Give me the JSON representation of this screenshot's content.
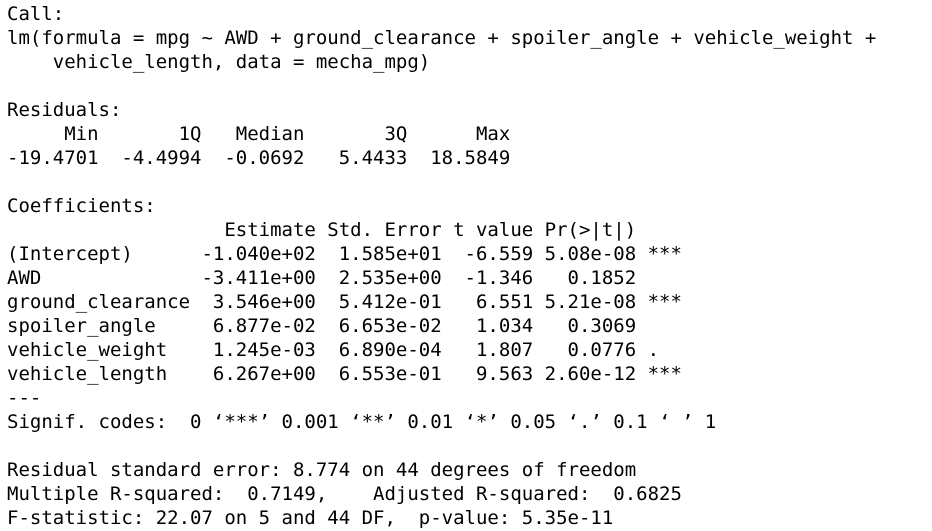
{
  "console": {
    "text_color": "#000000",
    "background_color": "#ffffff",
    "lines": [
      "Call:",
      "lm(formula = mpg ~ AWD + ground_clearance + spoiler_angle + vehicle_weight +",
      "    vehicle_length, data = mecha_mpg)",
      "",
      "Residuals:",
      "     Min       1Q   Median       3Q      Max ",
      "-19.4701  -4.4994  -0.0692   5.4433  18.5849 ",
      "",
      "Coefficients:",
      "                   Estimate Std. Error t value Pr(>|t|)    ",
      "(Intercept)      -1.040e+02  1.585e+01  -6.559 5.08e-08 ***",
      "AWD              -3.411e+00  2.535e+00  -1.346   0.1852    ",
      "ground_clearance  3.546e+00  5.412e-01   6.551 5.21e-08 ***",
      "spoiler_angle     6.877e-02  6.653e-02   1.034   0.3069    ",
      "vehicle_weight    1.245e-03  6.890e-04   1.807   0.0776 .  ",
      "vehicle_length    6.267e+00  6.553e-01   9.563 2.60e-12 ***",
      "---",
      "Signif. codes:  0 ‘***’ 0.001 ‘**’ 0.01 ‘*’ 0.05 ‘.’ 0.1 ‘ ’ 1",
      "",
      "Residual standard error: 8.774 on 44 degrees of freedom",
      "Multiple R-squared:  0.7149,\tAdjusted R-squared:  0.6825 ",
      "F-statistic: 22.07 on 5 and 44 DF,  p-value: 5.35e-11"
    ]
  }
}
